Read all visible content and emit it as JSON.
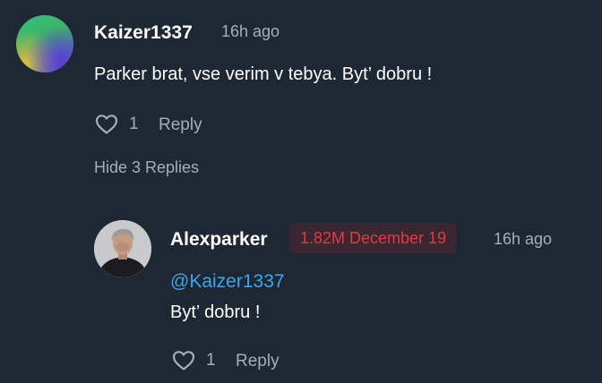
{
  "comment": {
    "username": "Kaizer1337",
    "time": "16h ago",
    "text": "Parker brat, vse verim v tebya. Byt’ dobru !",
    "likes": "1",
    "reply_label": "Reply",
    "hide_replies_label": "Hide 3 Replies",
    "avatar_colors": [
      "#2fc57a",
      "#e0c23a",
      "#5a3fc8"
    ]
  },
  "reply": {
    "username": "Alexparker",
    "badge": "1.82M December 19",
    "time": "16h ago",
    "mention": "@Kaizer1337",
    "text": "Byt’ dobru !",
    "likes": "1",
    "reply_label": "Reply"
  },
  "colors": {
    "background": "#1e2734",
    "muted": "#a3aebd",
    "mention": "#3aa7ea",
    "badge_text": "#e23a3f",
    "badge_bg": "#3a2630"
  },
  "icons": [
    "heart-icon",
    "avatar-gradient",
    "avatar-photo"
  ]
}
